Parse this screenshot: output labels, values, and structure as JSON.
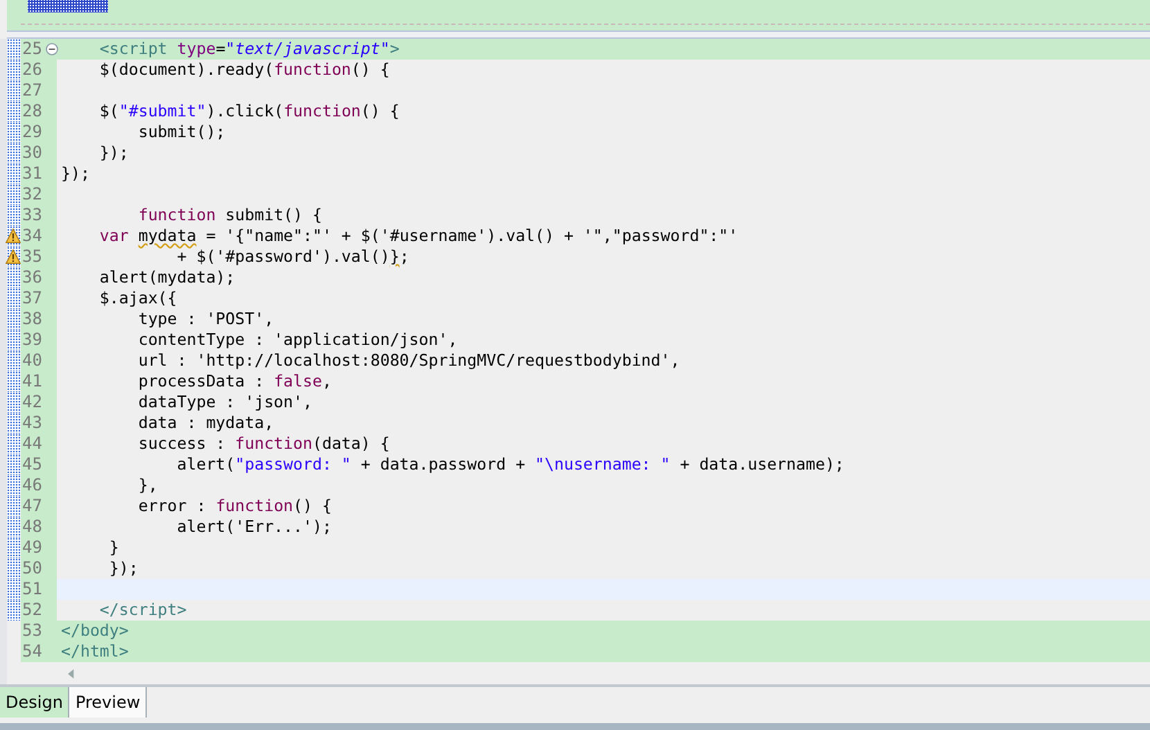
{
  "editor": {
    "lines": [
      {
        "number": "25",
        "changed": true,
        "highlighted": true,
        "current": false,
        "warning": false,
        "foldable": true,
        "tokens": [
          {
            "kind": "tag",
            "text": "    <script "
          },
          {
            "kind": "attr",
            "text": "type"
          },
          {
            "kind": "plain",
            "text": "="
          },
          {
            "kind": "value",
            "text": "\"text/javascript\""
          },
          {
            "kind": "tag",
            "text": ">"
          }
        ]
      },
      {
        "number": "26",
        "changed": true,
        "highlighted": false,
        "current": false,
        "warning": false,
        "foldable": false,
        "tokens": [
          {
            "kind": "plain",
            "text": "    $(document).ready("
          },
          {
            "kind": "keyword",
            "text": "function"
          },
          {
            "kind": "plain",
            "text": "() {"
          }
        ]
      },
      {
        "number": "27",
        "changed": true,
        "highlighted": false,
        "current": false,
        "warning": false,
        "foldable": false
      },
      {
        "number": "28",
        "changed": true,
        "highlighted": false,
        "current": false,
        "warning": false,
        "foldable": false,
        "tokens": [
          {
            "kind": "plain",
            "text": "    $("
          },
          {
            "kind": "string",
            "text": "\"#submit\""
          },
          {
            "kind": "plain",
            "text": ").click("
          },
          {
            "kind": "keyword",
            "text": "function"
          },
          {
            "kind": "plain",
            "text": "() {"
          }
        ]
      },
      {
        "number": "29",
        "changed": true,
        "highlighted": false,
        "current": false,
        "warning": false,
        "foldable": false,
        "tokens": [
          {
            "kind": "plain",
            "text": "        submit();"
          }
        ]
      },
      {
        "number": "30",
        "changed": true,
        "highlighted": false,
        "current": false,
        "warning": false,
        "foldable": false,
        "tokens": [
          {
            "kind": "plain",
            "text": "    });"
          }
        ]
      },
      {
        "number": "31",
        "changed": true,
        "highlighted": false,
        "current": false,
        "warning": false,
        "foldable": false,
        "tokens": [
          {
            "kind": "plain",
            "text": "});"
          }
        ]
      },
      {
        "number": "32",
        "changed": true,
        "highlighted": false,
        "current": false,
        "warning": false,
        "foldable": false
      },
      {
        "number": "33",
        "changed": true,
        "highlighted": false,
        "current": false,
        "warning": false,
        "foldable": false,
        "tokens": [
          {
            "kind": "keyword",
            "text": "        function"
          },
          {
            "kind": "plain",
            "text": " submit() {"
          }
        ]
      },
      {
        "number": "34",
        "changed": true,
        "highlighted": false,
        "current": false,
        "warning": true,
        "foldable": false,
        "tokens": [
          {
            "kind": "keyword",
            "text": "    var "
          },
          {
            "kind": "warn",
            "text": "mydata"
          },
          {
            "kind": "plain",
            "text": " = '{\"name\":\"' + $('#username').val() + '\",\"password\":\"'"
          }
        ]
      },
      {
        "number": "35",
        "changed": true,
        "highlighted": false,
        "current": false,
        "warning": true,
        "foldable": false,
        "tokens": [
          {
            "kind": "plain",
            "text": "            + $('#password').val()"
          },
          {
            "kind": "warn",
            "text": "}"
          },
          {
            "kind": "plain",
            "text": ";"
          }
        ]
      },
      {
        "number": "36",
        "changed": true,
        "highlighted": false,
        "current": false,
        "warning": false,
        "foldable": false,
        "tokens": [
          {
            "kind": "plain",
            "text": "    alert(mydata);"
          }
        ]
      },
      {
        "number": "37",
        "changed": true,
        "highlighted": false,
        "current": false,
        "warning": false,
        "foldable": false,
        "tokens": [
          {
            "kind": "plain",
            "text": "    $.ajax({"
          }
        ]
      },
      {
        "number": "38",
        "changed": true,
        "highlighted": false,
        "current": false,
        "warning": false,
        "foldable": false,
        "tokens": [
          {
            "kind": "plain",
            "text": "        type : 'POST',"
          }
        ]
      },
      {
        "number": "39",
        "changed": true,
        "highlighted": false,
        "current": false,
        "warning": false,
        "foldable": false,
        "tokens": [
          {
            "kind": "plain",
            "text": "        contentType : 'application/json',"
          }
        ]
      },
      {
        "number": "40",
        "changed": true,
        "highlighted": false,
        "current": false,
        "warning": false,
        "foldable": false,
        "tokens": [
          {
            "kind": "plain",
            "text": "        url : 'http://localhost:8080/SpringMVC/requestbodybind',"
          }
        ]
      },
      {
        "number": "41",
        "changed": true,
        "highlighted": false,
        "current": false,
        "warning": false,
        "foldable": false,
        "tokens": [
          {
            "kind": "plain",
            "text": "        processData : "
          },
          {
            "kind": "keyword",
            "text": "false"
          },
          {
            "kind": "plain",
            "text": ","
          }
        ]
      },
      {
        "number": "42",
        "changed": true,
        "highlighted": false,
        "current": false,
        "warning": false,
        "foldable": false,
        "tokens": [
          {
            "kind": "plain",
            "text": "        dataType : 'json',"
          }
        ]
      },
      {
        "number": "43",
        "changed": true,
        "highlighted": false,
        "current": false,
        "warning": false,
        "foldable": false,
        "tokens": [
          {
            "kind": "plain",
            "text": "        data : mydata,"
          }
        ]
      },
      {
        "number": "44",
        "changed": true,
        "highlighted": false,
        "current": false,
        "warning": false,
        "foldable": false,
        "tokens": [
          {
            "kind": "plain",
            "text": "        success : "
          },
          {
            "kind": "keyword",
            "text": "function"
          },
          {
            "kind": "plain",
            "text": "(data) {"
          }
        ]
      },
      {
        "number": "45",
        "changed": true,
        "highlighted": false,
        "current": false,
        "warning": false,
        "foldable": false,
        "tokens": [
          {
            "kind": "plain",
            "text": "            alert("
          },
          {
            "kind": "string",
            "text": "\"password: \""
          },
          {
            "kind": "plain",
            "text": " + data.password + "
          },
          {
            "kind": "string",
            "text": "\"\\nusername: \""
          },
          {
            "kind": "plain",
            "text": " + data.username);"
          }
        ]
      },
      {
        "number": "46",
        "changed": true,
        "highlighted": false,
        "current": false,
        "warning": false,
        "foldable": false,
        "tokens": [
          {
            "kind": "plain",
            "text": "        },"
          }
        ]
      },
      {
        "number": "47",
        "changed": true,
        "highlighted": false,
        "current": false,
        "warning": false,
        "foldable": false,
        "tokens": [
          {
            "kind": "plain",
            "text": "        error : "
          },
          {
            "kind": "keyword",
            "text": "function"
          },
          {
            "kind": "plain",
            "text": "() {"
          }
        ]
      },
      {
        "number": "48",
        "changed": true,
        "highlighted": false,
        "current": false,
        "warning": false,
        "foldable": false,
        "tokens": [
          {
            "kind": "plain",
            "text": "            alert('Err...');"
          }
        ]
      },
      {
        "number": "49",
        "changed": true,
        "highlighted": false,
        "current": false,
        "warning": false,
        "foldable": false,
        "tokens": [
          {
            "kind": "plain",
            "text": "     }"
          }
        ]
      },
      {
        "number": "50",
        "changed": true,
        "highlighted": false,
        "current": false,
        "warning": false,
        "foldable": false,
        "tokens": [
          {
            "kind": "plain",
            "text": "     });"
          }
        ]
      },
      {
        "number": "51",
        "changed": true,
        "highlighted": false,
        "current": true,
        "warning": false,
        "foldable": false
      },
      {
        "number": "52",
        "changed": true,
        "highlighted": false,
        "current": false,
        "warning": false,
        "foldable": false,
        "tokens": [
          {
            "kind": "tag",
            "text": "    </script>"
          }
        ]
      },
      {
        "number": "53",
        "changed": false,
        "highlighted": true,
        "current": false,
        "warning": false,
        "foldable": false,
        "tokens": [
          {
            "kind": "tag",
            "text": "</body>"
          }
        ]
      },
      {
        "number": "54",
        "changed": false,
        "highlighted": true,
        "current": false,
        "warning": false,
        "foldable": false,
        "tokens": [
          {
            "kind": "tag",
            "text": "</html>"
          }
        ]
      }
    ]
  },
  "tabs": [
    {
      "label": "Design",
      "selected": true
    },
    {
      "label": "Preview",
      "selected": false
    }
  ]
}
